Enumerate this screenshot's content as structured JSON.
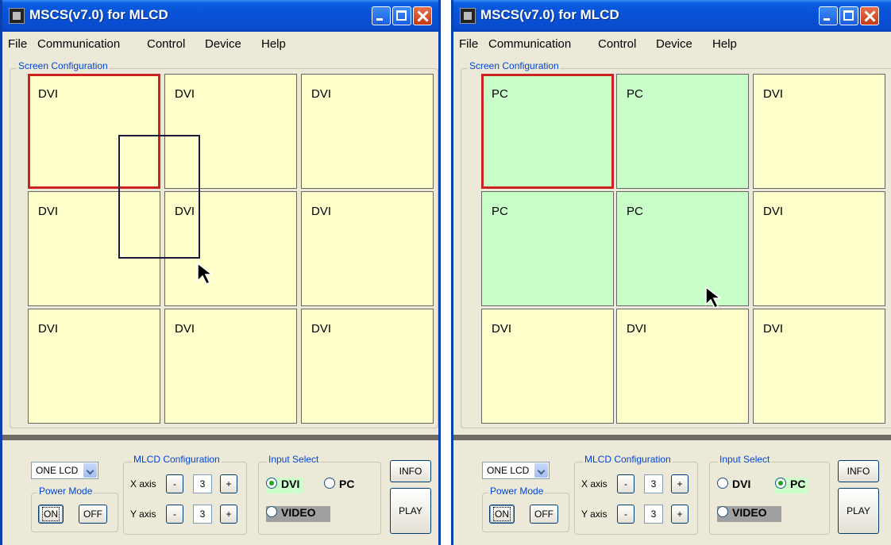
{
  "windows": [
    {
      "title": "MSCS(v7.0) for MLCD",
      "menu": [
        "File",
        "Communication",
        "Control",
        "Device",
        "Help"
      ],
      "screen_group_label": "Screen Configuration",
      "cells": [
        "DVI",
        "DVI",
        "DVI",
        "DVI",
        "DVI",
        "DVI",
        "DVI",
        "DVI",
        "DVI"
      ],
      "mode_select": "ONE LCD",
      "power_mode": {
        "label": "Power Mode",
        "on": "ON",
        "off": "OFF"
      },
      "mlcd_config": {
        "label": "MLCD Configuration",
        "x_label": "X axis",
        "x_value": "3",
        "y_label": "Y axis",
        "y_value": "3",
        "minus": "-",
        "plus": "+"
      },
      "input_select": {
        "label": "Input Select",
        "dvi": "DVI",
        "pc": "PC",
        "video": "VIDEO",
        "selected": "DVI"
      },
      "info": "INFO",
      "play": "PLAY"
    },
    {
      "title": "MSCS(v7.0) for MLCD",
      "menu": [
        "File",
        "Communication",
        "Control",
        "Device",
        "Help"
      ],
      "screen_group_label": "Screen Configuration",
      "cells": [
        "PC",
        "PC",
        "DVI",
        "PC",
        "PC",
        "DVI",
        "DVI",
        "DVI",
        "DVI"
      ],
      "mode_select": "ONE LCD",
      "power_mode": {
        "label": "Power Mode",
        "on": "ON",
        "off": "OFF"
      },
      "mlcd_config": {
        "label": "MLCD Configuration",
        "x_label": "X axis",
        "x_value": "3",
        "y_label": "Y axis",
        "y_value": "3",
        "minus": "-",
        "plus": "+"
      },
      "input_select": {
        "label": "Input Select",
        "dvi": "DVI",
        "pc": "PC",
        "video": "VIDEO",
        "selected": "PC"
      },
      "info": "INFO",
      "play": "PLAY"
    }
  ],
  "colors": {
    "dvi_cell": "#ffffcc",
    "pc_cell": "#c8ffc8",
    "selected_border": "#cc2222",
    "title_bar": "#0a5ce0"
  }
}
